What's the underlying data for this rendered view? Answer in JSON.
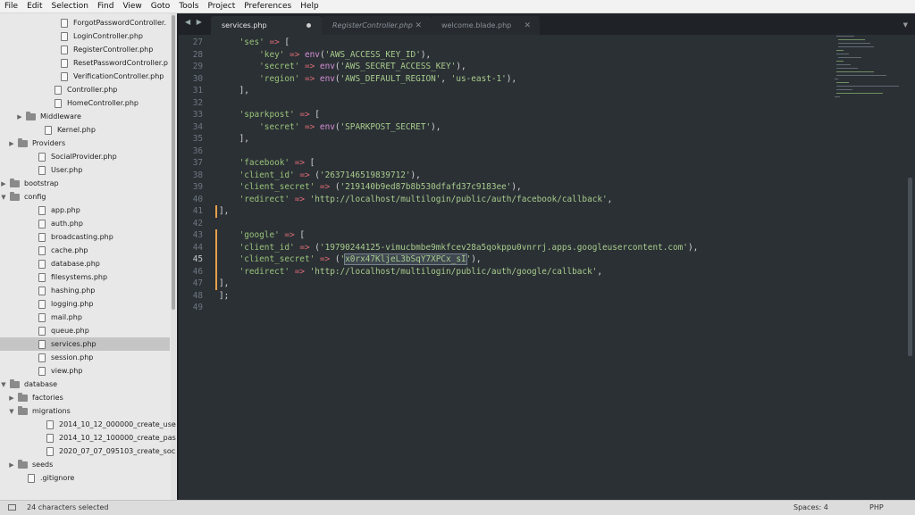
{
  "menubar": [
    "File",
    "Edit",
    "Selection",
    "Find",
    "View",
    "Goto",
    "Tools",
    "Project",
    "Preferences",
    "Help"
  ],
  "sidebar": [
    {
      "label": "ForgotPasswordController.",
      "type": "file"
    },
    {
      "label": "LoginController.php",
      "type": "file"
    },
    {
      "label": "RegisterController.php",
      "type": "file"
    },
    {
      "label": "ResetPasswordController.p",
      "type": "file"
    },
    {
      "label": "VerificationController.php",
      "type": "file"
    },
    {
      "label": "Controller.php",
      "type": "file"
    },
    {
      "label": "HomeController.php",
      "type": "file"
    },
    {
      "label": "Middleware",
      "type": "folder",
      "state": "closed"
    },
    {
      "label": "Kernel.php",
      "type": "file"
    },
    {
      "label": "Providers",
      "type": "folder",
      "state": "closed"
    },
    {
      "label": "SocialProvider.php",
      "type": "file"
    },
    {
      "label": "User.php",
      "type": "file"
    },
    {
      "label": "bootstrap",
      "type": "folder",
      "state": "closed"
    },
    {
      "label": "config",
      "type": "folder",
      "state": "open"
    },
    {
      "label": "app.php",
      "type": "file"
    },
    {
      "label": "auth.php",
      "type": "file"
    },
    {
      "label": "broadcasting.php",
      "type": "file"
    },
    {
      "label": "cache.php",
      "type": "file"
    },
    {
      "label": "database.php",
      "type": "file"
    },
    {
      "label": "filesystems.php",
      "type": "file"
    },
    {
      "label": "hashing.php",
      "type": "file"
    },
    {
      "label": "logging.php",
      "type": "file"
    },
    {
      "label": "mail.php",
      "type": "file"
    },
    {
      "label": "queue.php",
      "type": "file"
    },
    {
      "label": "services.php",
      "type": "file",
      "selected": true
    },
    {
      "label": "session.php",
      "type": "file"
    },
    {
      "label": "view.php",
      "type": "file"
    },
    {
      "label": "database",
      "type": "folder",
      "state": "open"
    },
    {
      "label": "factories",
      "type": "folder",
      "state": "closed"
    },
    {
      "label": "migrations",
      "type": "folder",
      "state": "open"
    },
    {
      "label": "2014_10_12_000000_create_use",
      "type": "file"
    },
    {
      "label": "2014_10_12_100000_create_pas",
      "type": "file"
    },
    {
      "label": "2020_07_07_095103_create_soc",
      "type": "file"
    },
    {
      "label": "seeds",
      "type": "folder",
      "state": "closed"
    },
    {
      "label": ".gitignore",
      "type": "file"
    }
  ],
  "tabs": [
    {
      "label": "services.php",
      "state": "active-modified"
    },
    {
      "label": "RegisterController.php",
      "state": "inactive"
    },
    {
      "label": "welcome.blade.php",
      "state": "inactive"
    }
  ],
  "nav_arrows": "◀ ▶",
  "tab_dropdown": "▼",
  "code_lines": [
    {
      "n": "27",
      "parts": [
        {
          "t": "    "
        },
        {
          "t": "'ses'",
          "c": "k"
        },
        {
          "t": " "
        },
        {
          "t": "=>",
          "c": "op"
        },
        {
          "t": " ["
        }
      ]
    },
    {
      "n": "28",
      "parts": [
        {
          "t": "        "
        },
        {
          "t": "'key'",
          "c": "k"
        },
        {
          "t": " "
        },
        {
          "t": "=>",
          "c": "op"
        },
        {
          "t": " "
        },
        {
          "t": "env",
          "c": "fn"
        },
        {
          "t": "("
        },
        {
          "t": "'AWS_ACCESS_KEY_ID'",
          "c": "s"
        },
        {
          "t": "),"
        }
      ]
    },
    {
      "n": "29",
      "parts": [
        {
          "t": "        "
        },
        {
          "t": "'secret'",
          "c": "k"
        },
        {
          "t": " "
        },
        {
          "t": "=>",
          "c": "op"
        },
        {
          "t": " "
        },
        {
          "t": "env",
          "c": "fn"
        },
        {
          "t": "("
        },
        {
          "t": "'AWS_SECRET_ACCESS_KEY'",
          "c": "s"
        },
        {
          "t": "),"
        }
      ]
    },
    {
      "n": "30",
      "parts": [
        {
          "t": "        "
        },
        {
          "t": "'region'",
          "c": "k"
        },
        {
          "t": " "
        },
        {
          "t": "=>",
          "c": "op"
        },
        {
          "t": " "
        },
        {
          "t": "env",
          "c": "fn"
        },
        {
          "t": "("
        },
        {
          "t": "'AWS_DEFAULT_REGION'",
          "c": "s"
        },
        {
          "t": ", "
        },
        {
          "t": "'us-east-1'",
          "c": "s"
        },
        {
          "t": "),"
        }
      ]
    },
    {
      "n": "31",
      "parts": [
        {
          "t": "    ],"
        }
      ]
    },
    {
      "n": "32",
      "parts": []
    },
    {
      "n": "33",
      "parts": [
        {
          "t": "    "
        },
        {
          "t": "'sparkpost'",
          "c": "k"
        },
        {
          "t": " "
        },
        {
          "t": "=>",
          "c": "op"
        },
        {
          "t": " ["
        }
      ]
    },
    {
      "n": "34",
      "parts": [
        {
          "t": "        "
        },
        {
          "t": "'secret'",
          "c": "k"
        },
        {
          "t": " "
        },
        {
          "t": "=>",
          "c": "op"
        },
        {
          "t": " "
        },
        {
          "t": "env",
          "c": "fn"
        },
        {
          "t": "("
        },
        {
          "t": "'SPARKPOST_SECRET'",
          "c": "s"
        },
        {
          "t": "),"
        }
      ]
    },
    {
      "n": "35",
      "parts": [
        {
          "t": "    ],"
        }
      ]
    },
    {
      "n": "36",
      "parts": []
    },
    {
      "n": "37",
      "parts": [
        {
          "t": "    "
        },
        {
          "t": "'facebook'",
          "c": "k"
        },
        {
          "t": " "
        },
        {
          "t": "=>",
          "c": "op"
        },
        {
          "t": " ["
        }
      ]
    },
    {
      "n": "38",
      "parts": [
        {
          "t": "    "
        },
        {
          "t": "'client_id'",
          "c": "k"
        },
        {
          "t": " "
        },
        {
          "t": "=>",
          "c": "op"
        },
        {
          "t": " ("
        },
        {
          "t": "'2637146519839712'",
          "c": "s"
        },
        {
          "t": "),"
        }
      ]
    },
    {
      "n": "39",
      "parts": [
        {
          "t": "    "
        },
        {
          "t": "'client_secret'",
          "c": "k"
        },
        {
          "t": " "
        },
        {
          "t": "=>",
          "c": "op"
        },
        {
          "t": " ("
        },
        {
          "t": "'219140b9ed87b8b530dfafd37c9183ee'",
          "c": "s"
        },
        {
          "t": "),"
        }
      ]
    },
    {
      "n": "40",
      "parts": [
        {
          "t": "    "
        },
        {
          "t": "'redirect'",
          "c": "k"
        },
        {
          "t": " "
        },
        {
          "t": "=>",
          "c": "op"
        },
        {
          "t": " "
        },
        {
          "t": "'http://localhost/multilogin/public/auth/facebook/callback'",
          "c": "s"
        },
        {
          "t": ","
        }
      ]
    },
    {
      "n": "41",
      "parts": [
        {
          "t": "],"
        }
      ],
      "mark": true
    },
    {
      "n": "42",
      "parts": []
    },
    {
      "n": "43",
      "parts": [
        {
          "t": "    "
        },
        {
          "t": "'google'",
          "c": "k"
        },
        {
          "t": " "
        },
        {
          "t": "=>",
          "c": "op"
        },
        {
          "t": " ["
        }
      ],
      "mark": true
    },
    {
      "n": "44",
      "parts": [
        {
          "t": "    "
        },
        {
          "t": "'client_id'",
          "c": "k"
        },
        {
          "t": " "
        },
        {
          "t": "=>",
          "c": "op"
        },
        {
          "t": " ("
        },
        {
          "t": "'19790244125-vimucbmbe9mkfcev28a5qokppu0vnrrj.apps.googleusercontent.com'",
          "c": "s"
        },
        {
          "t": "),"
        }
      ],
      "mark": true
    },
    {
      "n": "45",
      "parts": [
        {
          "t": "    "
        },
        {
          "t": "'client_secret'",
          "c": "k"
        },
        {
          "t": " "
        },
        {
          "t": "=>",
          "c": "op"
        },
        {
          "t": " ("
        },
        {
          "t": "'",
          "c": "s"
        },
        {
          "t": "x0rx47KljeL3bSqY7XPCx_sI",
          "c": "s hl"
        },
        {
          "t": "'",
          "c": "s"
        },
        {
          "t": "),"
        }
      ],
      "mark": true,
      "current": true
    },
    {
      "n": "46",
      "parts": [
        {
          "t": "    "
        },
        {
          "t": "'redirect'",
          "c": "k"
        },
        {
          "t": " "
        },
        {
          "t": "=>",
          "c": "op"
        },
        {
          "t": " "
        },
        {
          "t": "'http://localhost/multilogin/public/auth/google/callback'",
          "c": "s"
        },
        {
          "t": ","
        }
      ],
      "mark": true
    },
    {
      "n": "47",
      "parts": [
        {
          "t": "],"
        }
      ],
      "mark": true
    },
    {
      "n": "48",
      "parts": [
        {
          "t": "];"
        }
      ]
    },
    {
      "n": "49",
      "parts": []
    }
  ],
  "status": {
    "left": "24 characters selected",
    "spaces": "Spaces: 4",
    "syntax": "PHP"
  },
  "colors": {
    "accent_marker": "#e6a04a",
    "string": "#a8cc8c",
    "operator": "#e06c75",
    "function": "#d68fd6"
  }
}
